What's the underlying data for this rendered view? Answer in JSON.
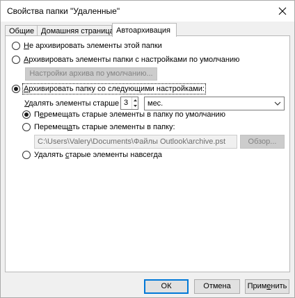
{
  "window": {
    "title": "Свойства папки \"Удаленные\""
  },
  "tabs": [
    {
      "label": "Общие",
      "active": false
    },
    {
      "label": "Домашняя страница",
      "active": false
    },
    {
      "label": "Автоархивация",
      "active": true
    }
  ],
  "autoarchive": {
    "opt_none": {
      "key": "Н",
      "rest": "е архивировать элементы этой папки"
    },
    "opt_default": {
      "key": "А",
      "rest": "рхивировать элементы папки с настройками по умолчанию"
    },
    "default_settings_button": "Настройки архива по умолчанию...",
    "opt_custom": {
      "key": "А",
      "rest": "рхивировать папку со следующими настройками:"
    },
    "delete_older_label": {
      "key": "У",
      "rest": "далять элементы старше"
    },
    "months_value": "3",
    "unit_value": "мес.",
    "move_default": {
      "pre": "П",
      "key": "е",
      "rest": "ремещать старые элементы в папку по умолчанию"
    },
    "move_to_folder": {
      "pre": "Перемещ",
      "key": "а",
      "rest": "ть старые элементы в папку:"
    },
    "archive_path": "C:\\Users\\Valery\\Documents\\Файлы Outlook\\archive.pst",
    "browse_button": "Обзор...",
    "delete_forever": {
      "pre": "Удалять ",
      "key": "с",
      "rest": "тарые элементы навсегда"
    }
  },
  "footer": {
    "ok": "ОК",
    "cancel": "Отмена",
    "apply": {
      "pre": "Прим",
      "key": "е",
      "rest": "нить"
    }
  }
}
